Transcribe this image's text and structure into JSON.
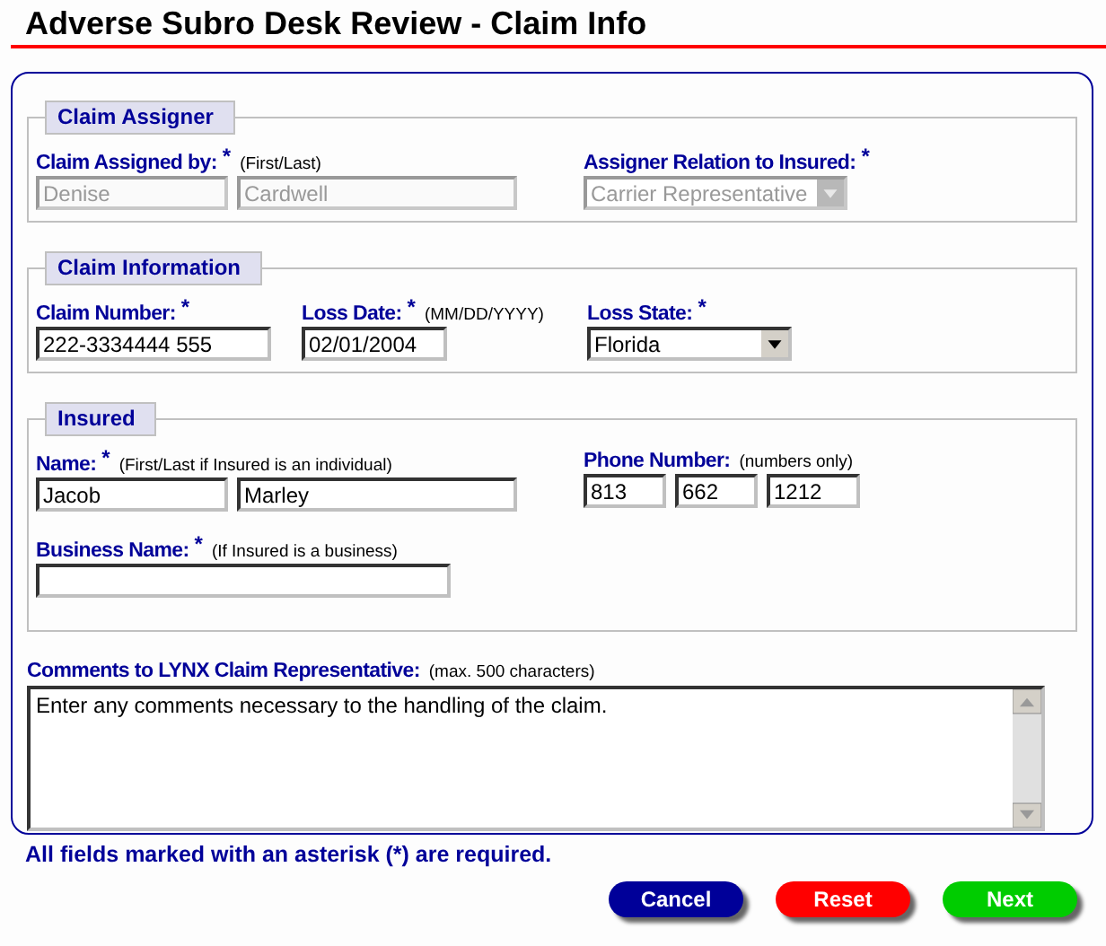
{
  "title": "Adverse Subro Desk Review - Claim Info",
  "sections": [
    {
      "legend": "Claim Assigner",
      "rows": [
        [
          {
            "label": "Claim Assigned by:",
            "asterisk": "*",
            "hint": "(First/Last)",
            "inputs": [
              {
                "kind": "text",
                "value": "Denise",
                "disabled": true
              },
              {
                "kind": "text",
                "value": "Cardwell",
                "disabled": true
              }
            ]
          },
          {
            "label": "Assigner Relation to Insured:",
            "asterisk": "*",
            "inputs": [
              {
                "kind": "select",
                "value": "Carrier Representative",
                "disabled": true
              }
            ]
          }
        ]
      ]
    },
    {
      "legend": "Claim Information",
      "rows": [
        [
          {
            "label": "Claim Number:",
            "asterisk": "*",
            "inputs": [
              {
                "kind": "text",
                "value": "222-3334444 555",
                "disabled": false
              }
            ]
          },
          {
            "label": "Loss Date:",
            "asterisk": "*",
            "hint": "(MM/DD/YYYY)",
            "inputs": [
              {
                "kind": "text",
                "value": "02/01/2004",
                "disabled": false
              }
            ]
          },
          {
            "label": "Loss State:",
            "asterisk": "*",
            "inputs": [
              {
                "kind": "select",
                "value": "Florida",
                "disabled": false
              }
            ]
          }
        ]
      ]
    },
    {
      "legend": "Insured",
      "rows": [
        [
          {
            "label": "Name:",
            "asterisk": "*",
            "hint": "(First/Last if Insured is an individual)",
            "inputs": [
              {
                "kind": "text",
                "value": "Jacob",
                "disabled": false
              },
              {
                "kind": "text",
                "value": "Marley",
                "disabled": false
              }
            ]
          },
          {
            "label": "Phone Number:",
            "hint": "(numbers only)",
            "inputs": [
              {
                "kind": "text",
                "value": "813",
                "disabled": false
              },
              {
                "kind": "text",
                "value": "662",
                "disabled": false
              },
              {
                "kind": "text",
                "value": "1212",
                "disabled": false
              }
            ]
          }
        ],
        [
          {
            "label": "Business Name:",
            "asterisk": "*",
            "hint": "(If Insured is a business)",
            "inputs": [
              {
                "kind": "text",
                "disabled": false
              }
            ]
          }
        ]
      ]
    }
  ],
  "comments": {
    "label": "Comments to LYNX Claim Representative:",
    "hint": "(max. 500 characters)",
    "value": "Enter any comments necessary to the handling of the claim."
  },
  "note": "All fields marked with an asterisk (*) are required.",
  "buttons": [
    {
      "label": "Cancel",
      "color": "#000099"
    },
    {
      "label": "Reset",
      "color": "#ff0000"
    },
    {
      "label": "Next",
      "color": "#00cc00"
    }
  ]
}
